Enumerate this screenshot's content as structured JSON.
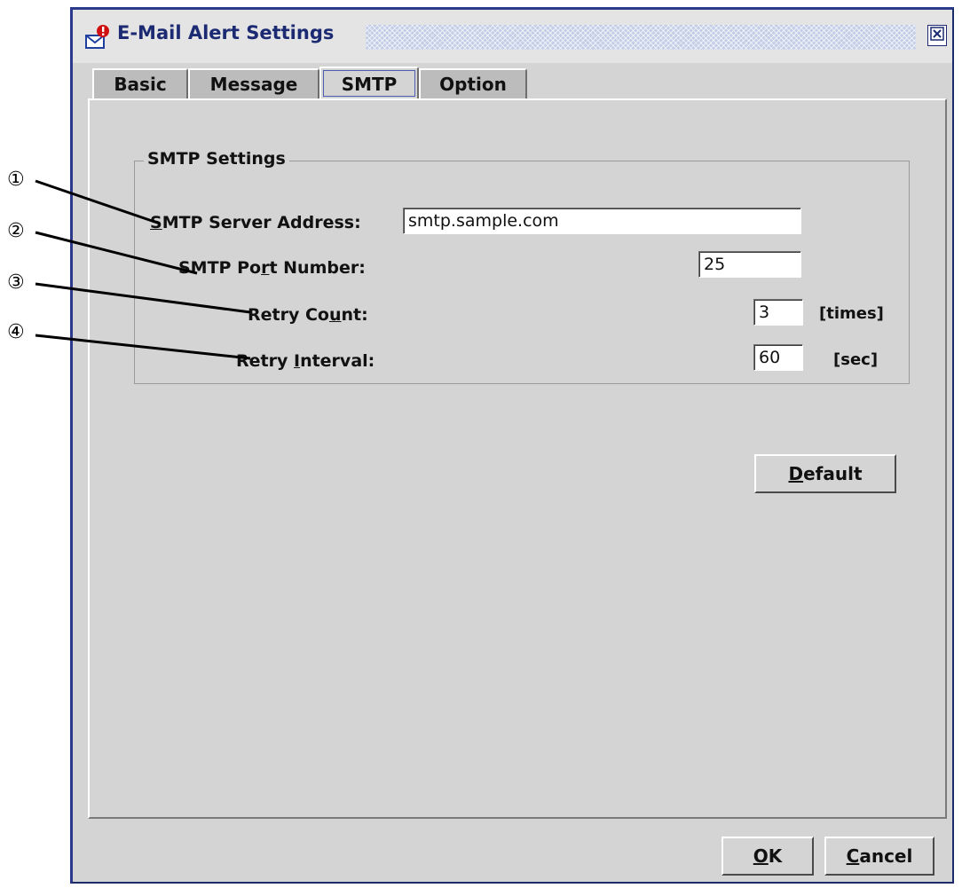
{
  "window": {
    "title": "E-Mail Alert Settings"
  },
  "tabs": [
    {
      "label": "Basic"
    },
    {
      "label": "Message"
    },
    {
      "label": "SMTP",
      "active": true
    },
    {
      "label": "Option"
    }
  ],
  "smtp_group": {
    "legend": "SMTP Settings",
    "server_address": {
      "label_mnemonic": "S",
      "label_rest": "MTP Server Address:",
      "value": "smtp.sample.com"
    },
    "port_number": {
      "label_pre": "SMTP Po",
      "label_mnemonic": "r",
      "label_post": "t Number:",
      "value": "25"
    },
    "retry_count": {
      "label_pre": "Retry Co",
      "label_mnemonic": "u",
      "label_post": "nt:",
      "value": "3",
      "unit": "[times]"
    },
    "retry_interval": {
      "label_pre": "Retry ",
      "label_mnemonic": "I",
      "label_post": "nterval:",
      "value": "60",
      "unit": "[sec]"
    }
  },
  "buttons": {
    "default": {
      "mnemonic": "D",
      "rest": "efault"
    },
    "ok": {
      "mnemonic": "O",
      "rest": "K"
    },
    "cancel": {
      "mnemonic": "C",
      "rest": "ancel"
    }
  },
  "annotations": [
    "①",
    "②",
    "③",
    "④"
  ],
  "colors": {
    "title_text": "#1b2a72",
    "window_bg": "#d4d4d4",
    "frame": "#2b3a8a"
  },
  "icons": {
    "title": "mail-alert-icon",
    "close": "close-icon"
  }
}
